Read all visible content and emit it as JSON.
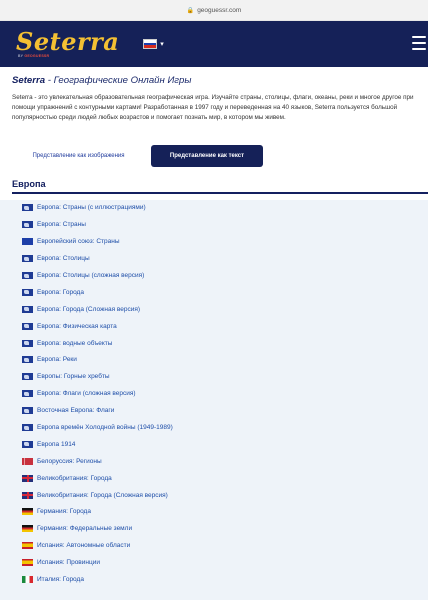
{
  "browser": {
    "url": "geoguessr.com",
    "lock_icon": "lock-icon"
  },
  "header": {
    "logo_text": "Seterra",
    "logo_sub_prefix": "BY",
    "logo_sub_brand": "GEOGUESSR",
    "language_flag": "flag-ru",
    "colors": {
      "bar": "#152158",
      "logo": "#f4c033"
    }
  },
  "intro": {
    "title_brand": "Seterra",
    "title_rest": " - Географические Онлайн Игры",
    "description": "Seterra - это увлекательная образовательная географическая игра. Изучайте страны, столицы, флаги, океаны, реки и многое другое при помощи упражнений с контурными картами! Разработанная в 1997 году и переведенная на 40 языков, Seterra пользуется большой популярностью среди людей любых возрастов и помогает познать мир, в котором мы живем."
  },
  "toggle": {
    "image_view": "Представление как изображения",
    "text_view": "Представление как текст",
    "active": "text_view"
  },
  "section": {
    "title": "Европа",
    "items": [
      {
        "icon": "europe",
        "label": "Европа: Страны (с иллюстрациями)"
      },
      {
        "icon": "europe",
        "label": "Европа: Страны"
      },
      {
        "icon": "eu",
        "label": "Европейский союз: Страны"
      },
      {
        "icon": "europe",
        "label": "Европа: Столицы"
      },
      {
        "icon": "europe",
        "label": "Европа: Столицы (сложная версия)"
      },
      {
        "icon": "europe",
        "label": "Европа: Города"
      },
      {
        "icon": "europe",
        "label": "Европа: Города (Сложная версия)"
      },
      {
        "icon": "europe",
        "label": "Европа: Физическая карта"
      },
      {
        "icon": "europe",
        "label": "Европа: водные объекты"
      },
      {
        "icon": "europe",
        "label": "Европа: Реки"
      },
      {
        "icon": "europe",
        "label": "Европы: Горные хребты"
      },
      {
        "icon": "europe",
        "label": "Европа: Флаги (сложная версия)"
      },
      {
        "icon": "europe",
        "label": "Восточная Европа: Флаги"
      },
      {
        "icon": "europe",
        "label": "Европа времён Холодной войны (1949-1989)"
      },
      {
        "icon": "europe",
        "label": "Европа 1914"
      },
      {
        "icon": "by",
        "label": "Белоруссия: Регионы"
      },
      {
        "icon": "gb",
        "label": "Великобритания: Города"
      },
      {
        "icon": "gb",
        "label": "Великобритания: Города (Сложная версия)"
      },
      {
        "icon": "de",
        "label": "Германия: Города"
      },
      {
        "icon": "de",
        "label": "Германия: Федеральные земли"
      },
      {
        "icon": "es",
        "label": "Испания: Автономные области"
      },
      {
        "icon": "es",
        "label": "Испания: Провинции"
      },
      {
        "icon": "it",
        "label": "Италия: Города"
      }
    ]
  }
}
